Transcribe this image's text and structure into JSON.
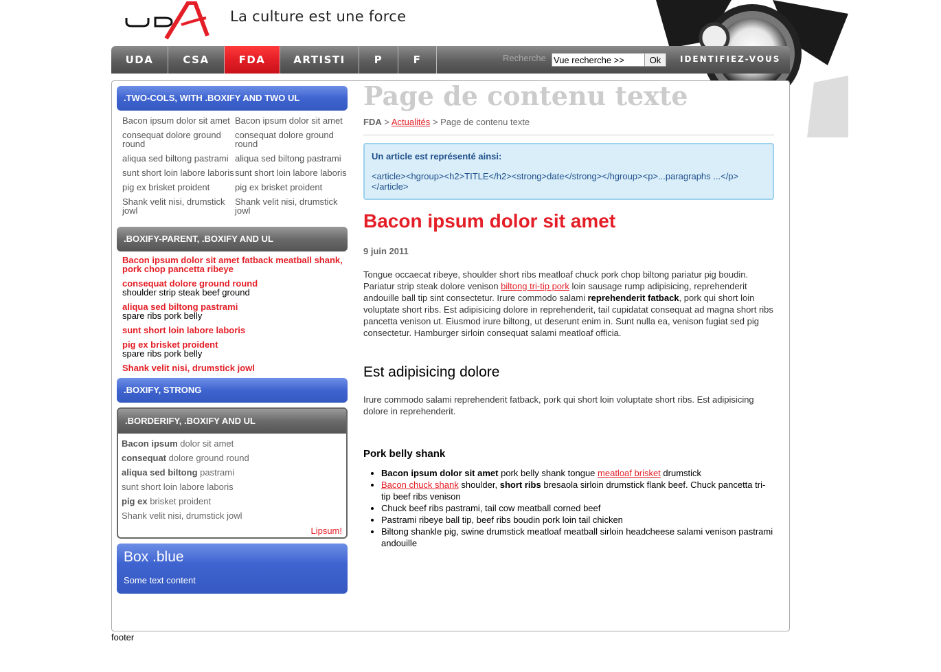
{
  "header": {
    "logo_text": "UDA",
    "tagline": "La culture est une force"
  },
  "nav": {
    "items": [
      {
        "label": "UDA",
        "active": false
      },
      {
        "label": "CSA",
        "active": false
      },
      {
        "label": "FDA",
        "active": true
      },
      {
        "label": "ARTISTI",
        "active": false
      },
      {
        "label": "P",
        "active": false
      },
      {
        "label": "F",
        "active": false
      }
    ],
    "search_label": "Recherche",
    "search_value": "Vue recherche >>",
    "search_button": "Ok",
    "login_label": "IDENTIFIEZ-VOUS"
  },
  "sidebar": {
    "box1": {
      "title": ".TWO-COLS, WITH .BOXIFY AND TWO UL",
      "col1": [
        "Bacon ipsum dolor sit amet",
        "consequat dolore ground round",
        "aliqua sed biltong pastrami",
        "sunt short loin labore laboris",
        "pig ex brisket proident",
        "Shank velit nisi, drumstick jowl"
      ],
      "col2": [
        "Bacon ipsum dolor sit amet",
        "consequat dolore ground round",
        "aliqua sed biltong pastrami",
        "sunt short loin labore laboris",
        "pig ex brisket proident",
        "Shank velit nisi, drumstick jowl"
      ]
    },
    "box2": {
      "title": ".BOXIFY-PARENT, .BOXIFY AND UL",
      "items": [
        {
          "title": "Bacon ipsum dolor sit amet fatback meatball shank, pork chop pancetta ribeye",
          "sub": ""
        },
        {
          "title": "consequat dolore ground round",
          "sub": "shoulder strip steak beef ground"
        },
        {
          "title": "aliqua sed biltong pastrami",
          "sub": "spare ribs pork belly"
        },
        {
          "title": "sunt short loin labore laboris",
          "sub": ""
        },
        {
          "title": "pig ex brisket proident",
          "sub": "spare ribs pork belly"
        },
        {
          "title": "Shank velit nisi, drumstick jowl",
          "sub": ""
        }
      ]
    },
    "box3": {
      "title": ".BOXIFY, STRONG"
    },
    "box4": {
      "title": ".BORDERIFY, .BOXIFY AND UL",
      "items": [
        {
          "bold": "Bacon ipsum",
          "rest": " dolor sit amet"
        },
        {
          "bold": "consequat",
          "rest": " dolore ground round"
        },
        {
          "bold": "aliqua sed biltong",
          "rest": " pastrami"
        },
        {
          "bold": "",
          "rest": "sunt short loin labore laboris"
        },
        {
          "bold": "pig ex",
          "rest": " brisket proident"
        },
        {
          "bold": "",
          "rest": "Shank velit nisi, drumstick jowl"
        }
      ],
      "link": "Lipsum!"
    },
    "box5": {
      "title": "Box .blue",
      "text": "Some text content"
    }
  },
  "content": {
    "page_title": "Page de contenu texte",
    "breadcrumb": {
      "root": "FDA",
      "sep": ">",
      "link": "Actualités",
      "current": "Page de contenu texte"
    },
    "info": {
      "title": "Un article est représenté ainsi:",
      "code": "<article><hgroup><h2>TITLE</h2><strong>date</strong></hgroup><p>...paragraphs ...</p></article>"
    },
    "article_title": "Bacon ipsum dolor sit amet",
    "date": "9 juin 2011",
    "p1": {
      "a": "Tongue occaecat ribeye, shoulder short ribs meatloaf chuck pork chop biltong pariatur pig boudin. Pariatur strip steak dolore venison ",
      "link": "biltong tri-tip pork",
      "b": " loin sausage rump adipisicing, reprehenderit andouille ball tip sint consectetur. Irure commodo salami ",
      "bold": "reprehenderit fatback",
      "c": ", pork qui short loin voluptate short ribs. Est adipisicing dolore in reprehenderit, tail cupidatat consequat ad magna short ribs pancetta venison ut. Eiusmod irure biltong, ut deserunt enim in. Sunt nulla ea, venison fugiat sed pig consectetur. Hamburger sirloin consequat salami meatloaf officia."
    },
    "h2": "Est adipisicing dolore",
    "p2": "Irure commodo salami reprehenderit fatback, pork qui short loin voluptate short ribs. Est adipisicing dolore in reprehenderit.",
    "h3": "Pork belly shank",
    "bullets": {
      "b1_bold": "Bacon ipsum dolor sit amet",
      "b1_text": " pork belly shank tongue ",
      "b1_link": "meatloaf brisket",
      "b1_end": " drumstick",
      "b2_link": "Bacon chuck shank",
      "b2_text": " shoulder, ",
      "b2_bold": "short ribs",
      "b2_end": " bresaola sirloin drumstick flank beef. Chuck pancetta tri-tip beef ribs venison",
      "b3": "Chuck beef ribs pastrami, tail cow meatball corned beef",
      "b4": "Pastrami ribeye ball tip, beef ribs boudin pork loin tail chicken",
      "b5": "Biltong shankle pig, swine drumstick meatloaf meatball sirloin headcheese salami venison pastrami andouille"
    }
  },
  "footer": "footer",
  "colors": {
    "accent": "#e41e26",
    "blue": "#3f64d0",
    "info_bg": "#d9eef9"
  }
}
